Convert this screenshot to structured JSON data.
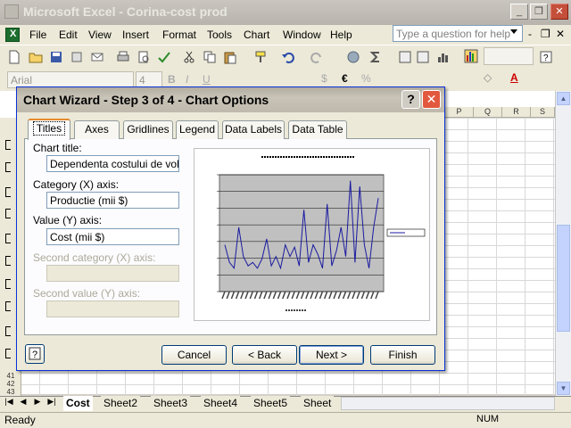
{
  "app": {
    "title": "Microsoft Excel - Corina-cost prod",
    "window_buttons": {
      "minimize": "_",
      "restore": "❐",
      "close": "✕"
    }
  },
  "menu": {
    "items": [
      "File",
      "Edit",
      "View",
      "Insert",
      "Format",
      "Tools",
      "Chart",
      "Window",
      "Help"
    ],
    "help_placeholder": "Type a question for help",
    "doc_controls": {
      "minimize": "-",
      "restore": "❐",
      "close": "✕"
    }
  },
  "formatting": {
    "font": "Arial",
    "size": "4"
  },
  "sheet": {
    "columns": [
      "P",
      "Q",
      "R",
      "S"
    ],
    "rows": [
      "41",
      "42",
      "43"
    ],
    "tabs": [
      "Cost",
      "Sheet2",
      "Sheet3",
      "Sheet4",
      "Sheet5",
      "Sheet"
    ],
    "active_tab": "Cost"
  },
  "status": {
    "ready": "Ready",
    "num": "NUM"
  },
  "dialog": {
    "title": "Chart Wizard - Step 3 of 4 - Chart Options",
    "title_help": "?",
    "title_close": "✕",
    "tabs": [
      "Titles",
      "Axes",
      "Gridlines",
      "Legend",
      "Data Labels",
      "Data Table"
    ],
    "selected_tab": "Titles",
    "fields": {
      "chart_title": {
        "label": "Chart title:",
        "value": "Dependenta costului de volum"
      },
      "category_x": {
        "label": "Category (X) axis:",
        "value": "Productie (mii $)"
      },
      "value_y": {
        "label": "Value (Y) axis:",
        "value": "Cost (mii $)"
      },
      "second_category_x": {
        "label": "Second category (X) axis:",
        "value": ""
      },
      "second_value_y": {
        "label": "Second value (Y) axis:",
        "value": ""
      }
    },
    "buttons": {
      "cancel": "Cancel",
      "back": "< Back",
      "next": "Next >",
      "finish": "Finish"
    }
  },
  "chart_data": {
    "type": "line",
    "title": "",
    "xlabel": "",
    "ylabel": "",
    "y": [
      40,
      25,
      20,
      55,
      30,
      22,
      25,
      20,
      28,
      45,
      22,
      30,
      20,
      40,
      30,
      38,
      22,
      70,
      25,
      40,
      32,
      20,
      75,
      22,
      35,
      55,
      30,
      95,
      25,
      90,
      40,
      20,
      55,
      80
    ],
    "ylim": [
      0,
      100
    ],
    "grid": true,
    "legend": "right",
    "colors": {
      "line": "#1a1aa0",
      "plot_bg": "#c0c0c0"
    }
  }
}
